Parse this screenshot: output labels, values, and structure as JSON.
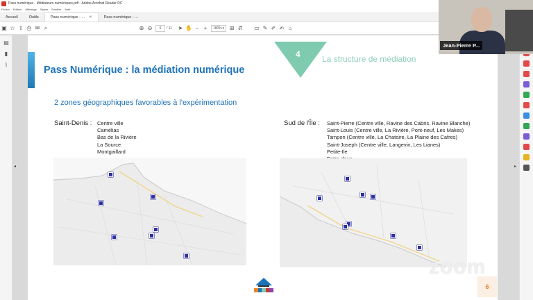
{
  "window": {
    "title": "Pass numérique - Médiateurs numériques.pdf - Adobe Acrobat Reader DC",
    "menu": [
      "Fichier",
      "Edition",
      "Affichage",
      "Signer",
      "Fenêtre",
      "Aide"
    ]
  },
  "tabs": [
    {
      "label": "Accueil",
      "active": false
    },
    {
      "label": "Outils",
      "active": false
    },
    {
      "label": "Pass numérique - ...",
      "active": true
    },
    {
      "label": "Pass numérique - ...",
      "active": false
    }
  ],
  "toolbar": {
    "page_current": "6",
    "page_total": "/ 11",
    "zoom_level": "180%"
  },
  "slide": {
    "number": "4",
    "section": "La structure de médiation",
    "title": "Pass Numérique : la médiation numérique",
    "subtitle": "2 zones géographiques favorables à l'expérimentation",
    "zone1": {
      "label": "Saint-Denis :",
      "places": [
        "Centre ville",
        "Camélias",
        "Bas de la Rivière",
        "La Source",
        "Montgaillard"
      ]
    },
    "zone2": {
      "label": "Sud de l'Île :",
      "places": [
        "Saint-Pierre (Centre ville, Ravine des Cabris, Ravine Blanche)",
        "Saint-Louis (Centre ville, La Rivière, Pont-neuf, Les Makes)",
        "Tampon (Centre ville, La Chatoire, La Plaine des Cafres)",
        "Saint-Joseph (Centre ville, Langevin, Les Lianes)",
        "Petite-Ile",
        "Entre-deux"
      ]
    },
    "page_number": "6",
    "colors": {
      "title_blue": "#1e73b8",
      "accent_green": "#7ecbb0",
      "pin": "#2e2fa0"
    }
  },
  "video": {
    "participant_name": "Jean-Pierre P..."
  },
  "watermark": "zoom"
}
